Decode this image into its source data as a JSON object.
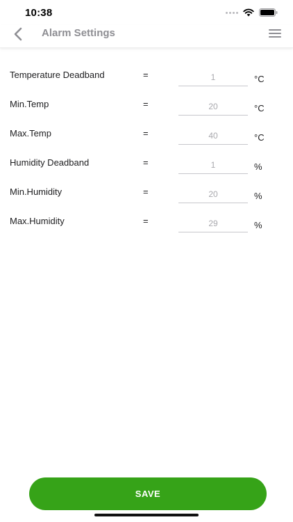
{
  "status_bar": {
    "time": "10:38"
  },
  "nav": {
    "title": "Alarm Settings",
    "back_icon": "chevron-left-icon",
    "menu_icon": "hamburger-menu-icon"
  },
  "settings": [
    {
      "label": "Temperature Deadband",
      "operator": "=",
      "value": "1",
      "unit": "°C"
    },
    {
      "label": "Min.Temp",
      "operator": "=",
      "value": "20",
      "unit": "°C"
    },
    {
      "label": "Max.Temp",
      "operator": "=",
      "value": "40",
      "unit": "°C"
    },
    {
      "label": "Humidity Deadband",
      "operator": "=",
      "value": "1",
      "unit": "%"
    },
    {
      "label": "Min.Humidity",
      "operator": "=",
      "value": "20",
      "unit": "%"
    },
    {
      "label": "Max.Humidity",
      "operator": "=",
      "value": "29",
      "unit": "%"
    }
  ],
  "save_label": "SAVE",
  "colors": {
    "accent": "#36a318",
    "title_gray": "#8e8e93"
  }
}
